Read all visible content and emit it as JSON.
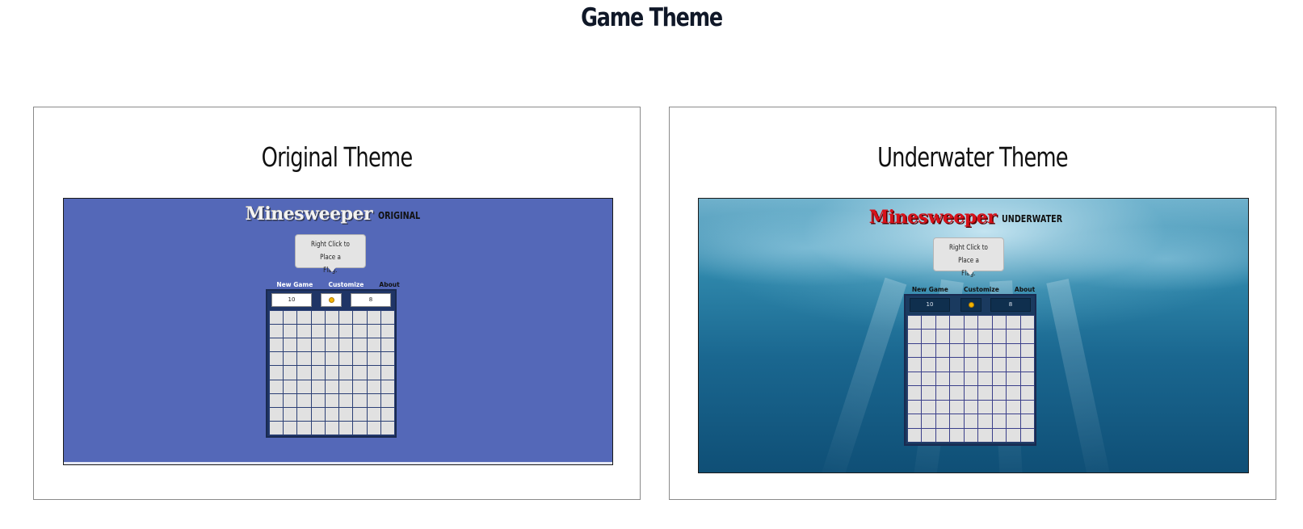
{
  "page": {
    "title": "Game Theme"
  },
  "themes": [
    {
      "heading": "Original Theme",
      "app_title": "Minesweeper",
      "theme_label": "ORIGINAL",
      "tooltip_line1": "Right Click to Place a",
      "tooltip_line2": "Flag.",
      "menu": [
        "New Game",
        "Customize",
        "About"
      ],
      "mine_counter": "10",
      "flag_counter": "8",
      "face_icon": "smiley-face-icon",
      "grid": {
        "rows": 9,
        "cols": 9
      },
      "colors": {
        "background": "#5468b8",
        "board": "#1f3566",
        "cell": "#e1e1e1"
      }
    },
    {
      "heading": "Underwater Theme",
      "app_title": "Minesweeper",
      "theme_label": "UNDERWATER",
      "tooltip_line1": "Right Click to Place a",
      "tooltip_line2": "Flag.",
      "menu": [
        "New Game",
        "Customize",
        "About"
      ],
      "mine_counter": "10",
      "flag_counter": "8",
      "face_icon": "smiley-face-icon",
      "grid": {
        "rows": 9,
        "cols": 9
      },
      "colors": {
        "background": "#1a6790",
        "title": "#d8121a",
        "board": "#1a3a5f",
        "cell": "#e1e1e1"
      }
    }
  ]
}
